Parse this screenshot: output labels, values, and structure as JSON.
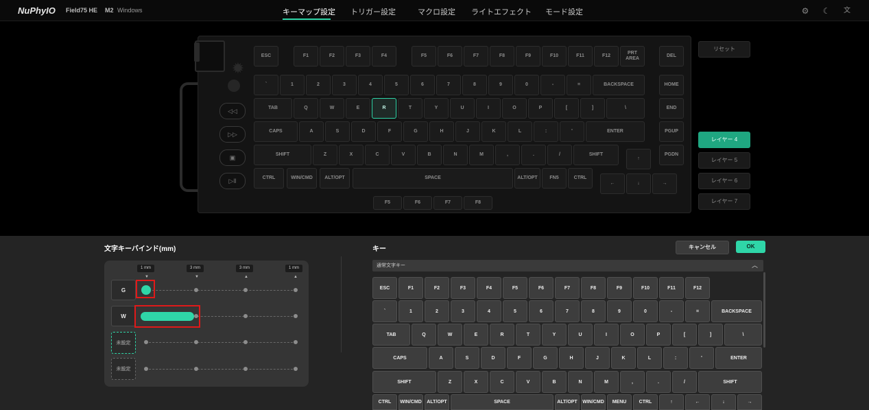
{
  "topbar": {
    "logo": "NuPhyIO",
    "model": "Field75 HE",
    "m2": "M2",
    "os": "Windows",
    "tabs": [
      {
        "label": "キーマップ設定"
      },
      {
        "label": "トリガー設定"
      },
      {
        "label": "マクロ設定"
      },
      {
        "label": "ライトエフェクト"
      },
      {
        "label": "モード設定"
      }
    ],
    "icons": [
      "settings-icon",
      "moon-icon",
      "translate-icon"
    ]
  },
  "keyboard": {
    "selected_key": "R",
    "media_icons": [
      "rewind-icon",
      "fast-forward-icon",
      "screen-icon",
      "play-pause-icon"
    ],
    "rows": {
      "r0": [
        "ESC",
        "F1",
        "F2",
        "F3",
        "F4",
        "F5",
        "F6",
        "F7",
        "F8",
        "F9",
        "F10",
        "F11",
        "F12",
        "PRT AREA",
        "DEL"
      ],
      "r1": [
        "`",
        "1",
        "2",
        "3",
        "4",
        "5",
        "6",
        "7",
        "8",
        "9",
        "0",
        "-",
        "=",
        "BACKSPACE",
        "HOME"
      ],
      "r2": [
        "TAB",
        "Q",
        "W",
        "E",
        "R",
        "T",
        "Y",
        "U",
        "I",
        "O",
        "P",
        "[",
        "]",
        "\\",
        "END"
      ],
      "r3": [
        "CAPS",
        "A",
        "S",
        "D",
        "F",
        "G",
        "H",
        "J",
        "K",
        "L",
        ":",
        "'",
        "ENTER",
        "PGUP"
      ],
      "r4": [
        "SHIFT",
        "Z",
        "X",
        "C",
        "V",
        "B",
        "N",
        "M",
        ",",
        ".",
        "/",
        "SHIFT",
        "↑",
        "PGDN"
      ],
      "r5": [
        "CTRL",
        "WIN/CMD",
        "ALT/OPT",
        "SPACE",
        "ALT/OPT",
        "FN5",
        "CTRL",
        "←",
        "↓",
        "→"
      ],
      "r6": [
        "F5",
        "F6",
        "F7",
        "F8"
      ]
    }
  },
  "right_panel": {
    "reset": "リセット",
    "layers": [
      "レイヤー 4",
      "レイヤー 5",
      "レイヤー 6",
      "レイヤー 7"
    ],
    "active_layer": "レイヤー 4"
  },
  "bind": {
    "title": "文字キーバインド(mm)",
    "mm_labels": [
      "1 mm",
      "3 mm",
      "3 mm",
      "1 mm"
    ],
    "rows": [
      {
        "key": "G"
      },
      {
        "key": "W"
      },
      {
        "key": "未設定"
      },
      {
        "key": "未設定"
      }
    ]
  },
  "keys_panel": {
    "title": "キー",
    "cancel": "キャンセル",
    "ok": "OK",
    "dropdown": "通常文字キー",
    "rows": {
      "r0": [
        "ESC",
        "F1",
        "F2",
        "F3",
        "F4",
        "F5",
        "F6",
        "F7",
        "F8",
        "F9",
        "F10",
        "F11",
        "F12"
      ],
      "r1": [
        "`",
        "1",
        "2",
        "3",
        "4",
        "5",
        "6",
        "7",
        "8",
        "9",
        "0",
        "-",
        "=",
        "BACKSPACE"
      ],
      "r2": [
        "TAB",
        "Q",
        "W",
        "E",
        "R",
        "T",
        "Y",
        "U",
        "I",
        "O",
        "P",
        "[",
        "]",
        "\\"
      ],
      "r3": [
        "CAPS",
        "A",
        "S",
        "D",
        "F",
        "G",
        "H",
        "J",
        "K",
        "L",
        ":",
        "'",
        "ENTER"
      ],
      "r4": [
        "SHIFT",
        "Z",
        "X",
        "C",
        "V",
        "B",
        "N",
        "M",
        ",",
        ".",
        "/",
        "SHIFT"
      ],
      "r5": [
        "CTRL",
        "WIN/CMD",
        "ALT/OPT",
        "SPACE",
        "ALT/OPT",
        "WIN/CMD",
        "MENU",
        "CTRL",
        "↑",
        "←",
        "↓",
        "→"
      ]
    }
  }
}
